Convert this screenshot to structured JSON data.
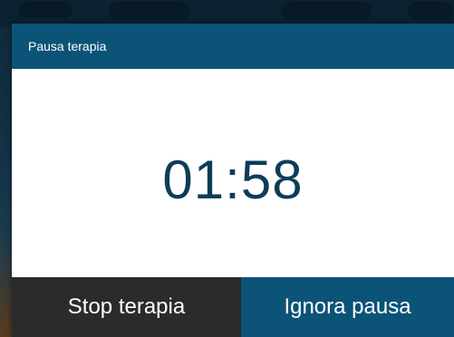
{
  "dialog": {
    "title": "Pausa terapia",
    "timer": "01:58",
    "stop_label": "Stop terapia",
    "ignore_label": "Ignora pausa"
  },
  "colors": {
    "header": "#0c5378",
    "timer_text": "#0c3d58",
    "stop_button": "#2b2b2b",
    "ignore_button": "#0c5378"
  }
}
